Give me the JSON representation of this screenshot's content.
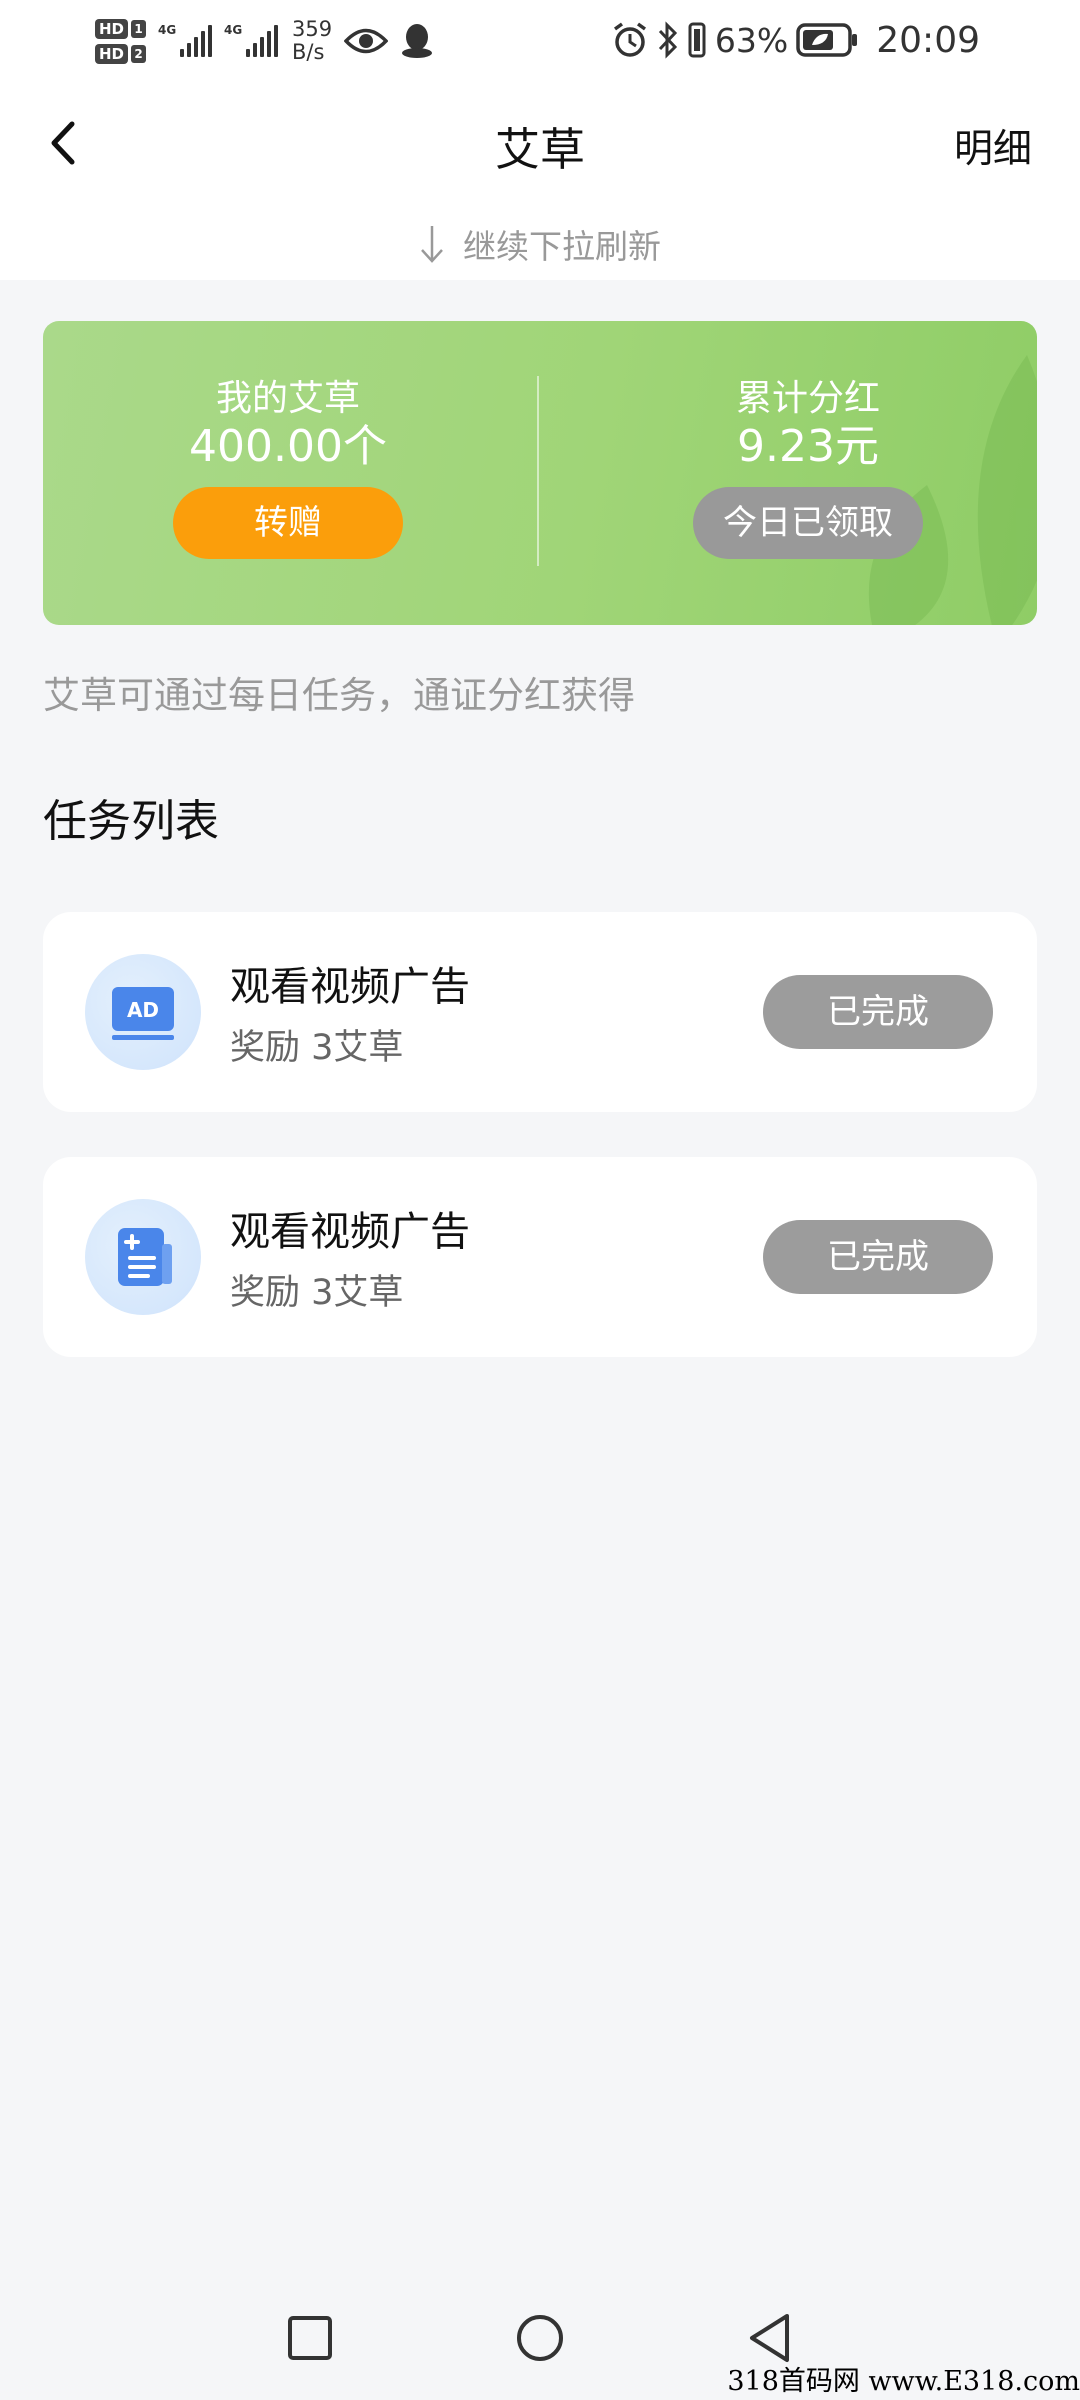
{
  "status_bar": {
    "network_speed": "359",
    "network_speed_unit": "B/s",
    "battery_percent": "63%",
    "time": "20:09",
    "sim_labels": [
      "HD",
      "1",
      "HD",
      "2"
    ],
    "signal_tags": [
      "4G",
      "4G"
    ],
    "icons": [
      "eye-icon",
      "qq-icon",
      "alarm-icon",
      "bluetooth-icon",
      "vibrate-icon",
      "battery-icon"
    ]
  },
  "header": {
    "title": "艾草",
    "detail_label": "明细",
    "refresh_hint": "继续下拉刷新"
  },
  "summary_card": {
    "my_label": "我的艾草",
    "my_value": "400.00个",
    "transfer_label": "转赠",
    "dividend_label": "累计分红",
    "dividend_value": "9.23元",
    "claimed_label": "今日已领取",
    "colors": {
      "card": "#a0d577",
      "transfer_button": "#fb9e0b",
      "claimed_button": "#999999"
    }
  },
  "info_text": "艾草可通过每日任务，通证分红获得",
  "task_section": {
    "title": "任务列表",
    "tasks": [
      {
        "title": "观看视频广告",
        "reward": "奖励 3艾草",
        "button": "已完成",
        "icon": "ad-icon"
      },
      {
        "title": "观看视频广告",
        "reward": "奖励 3艾草",
        "button": "已完成",
        "icon": "task-list-icon"
      }
    ]
  },
  "watermark": "318首码网 www.E318.com"
}
